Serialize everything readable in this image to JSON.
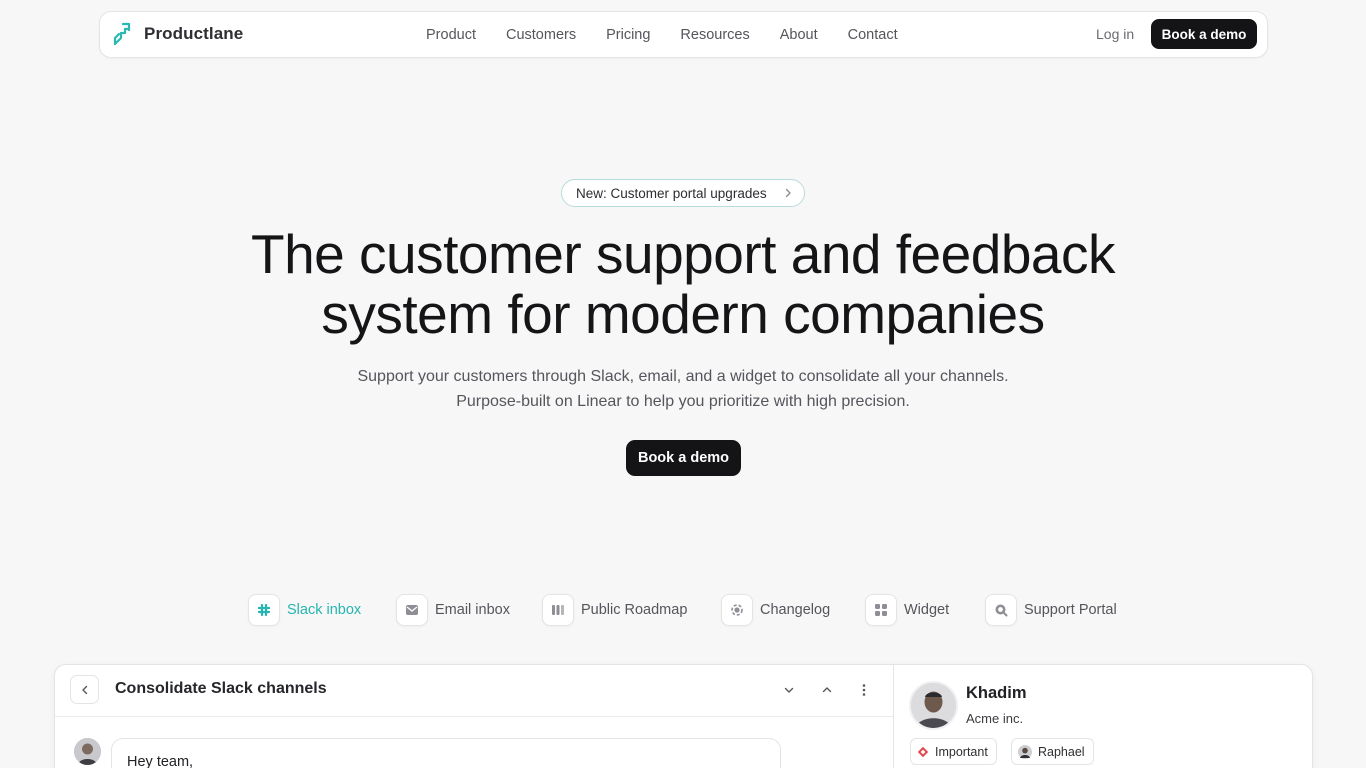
{
  "nav": {
    "brand": "Productlane",
    "links": [
      "Product",
      "Customers",
      "Pricing",
      "Resources",
      "About",
      "Contact"
    ],
    "login": "Log in",
    "cta": "Book a demo"
  },
  "hero": {
    "announcement": "New: Customer portal upgrades",
    "title_line1": "The customer support and feedback",
    "title_line2": "system for modern companies",
    "subtitle_line1": "Support your customers through Slack, email, and a widget to consolidate all your channels.",
    "subtitle_line2": "Purpose-built on Linear to help you prioritize with high precision.",
    "cta": "Book a demo"
  },
  "feature_tabs": [
    {
      "label": "Slack inbox",
      "icon": "slack-icon",
      "active": true
    },
    {
      "label": "Email inbox",
      "icon": "mail-icon",
      "active": false
    },
    {
      "label": "Public Roadmap",
      "icon": "roadmap-icon",
      "active": false
    },
    {
      "label": "Changelog",
      "icon": "changelog-icon",
      "active": false
    },
    {
      "label": "Widget",
      "icon": "widget-icon",
      "active": false
    },
    {
      "label": "Support Portal",
      "icon": "portal-icon",
      "active": false
    }
  ],
  "preview": {
    "thread_title": "Consolidate Slack channels",
    "message": "Hey team,",
    "contact": {
      "name": "Khadim",
      "company": "Acme inc.",
      "tags": [
        {
          "label": "Important",
          "icon": "diamond-icon"
        },
        {
          "label": "Raphael",
          "icon": "avatar"
        }
      ]
    }
  },
  "colors": {
    "accent": "#26b5b0",
    "dark_button": "#141416",
    "background": "#f7f7f7",
    "important": "#e5484d"
  }
}
